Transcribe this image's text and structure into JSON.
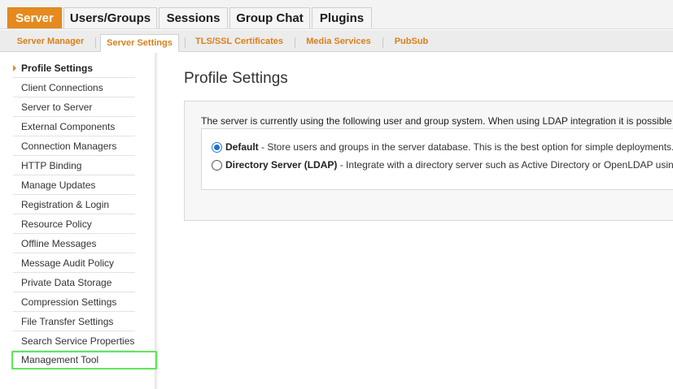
{
  "top_tabs": [
    {
      "label": "Server",
      "active": true
    },
    {
      "label": "Users/Groups",
      "active": false
    },
    {
      "label": "Sessions",
      "active": false
    },
    {
      "label": "Group Chat",
      "active": false
    },
    {
      "label": "Plugins",
      "active": false
    }
  ],
  "sub_tabs": [
    {
      "label": "Server Manager",
      "active": false
    },
    {
      "label": "Server Settings",
      "active": true
    },
    {
      "label": "TLS/SSL Certificates",
      "active": false
    },
    {
      "label": "Media Services",
      "active": false
    },
    {
      "label": "PubSub",
      "active": false
    }
  ],
  "sidebar": {
    "items": [
      {
        "label": "Profile Settings",
        "active": true
      },
      {
        "label": "Client Connections"
      },
      {
        "label": "Server to Server"
      },
      {
        "label": "External Components"
      },
      {
        "label": "Connection Managers"
      },
      {
        "label": "HTTP Binding"
      },
      {
        "label": "Manage Updates"
      },
      {
        "label": "Registration & Login"
      },
      {
        "label": "Resource Policy"
      },
      {
        "label": "Offline Messages"
      },
      {
        "label": "Message Audit Policy"
      },
      {
        "label": "Private Data Storage"
      },
      {
        "label": "Compression Settings"
      },
      {
        "label": "File Transfer Settings"
      },
      {
        "label": "Search Service Properties"
      },
      {
        "label": "Management Tool",
        "highlighted": true
      }
    ]
  },
  "main": {
    "title": "Profile Settings",
    "intro": "The server is currently using the following user and group system. When using LDAP integration it is possible",
    "options": [
      {
        "label": "Default",
        "description": " - Store users and groups in the server database. This is the best option for simple deployments.",
        "checked": true
      },
      {
        "label": "Directory Server (LDAP)",
        "description": " - Integrate with a directory server such as Active Directory or OpenLDAP usin",
        "checked": false
      }
    ]
  },
  "colors": {
    "accent": "#e58a1f",
    "highlight_outline": "#5ee65a",
    "radio_selected": "#1e6fd4"
  }
}
